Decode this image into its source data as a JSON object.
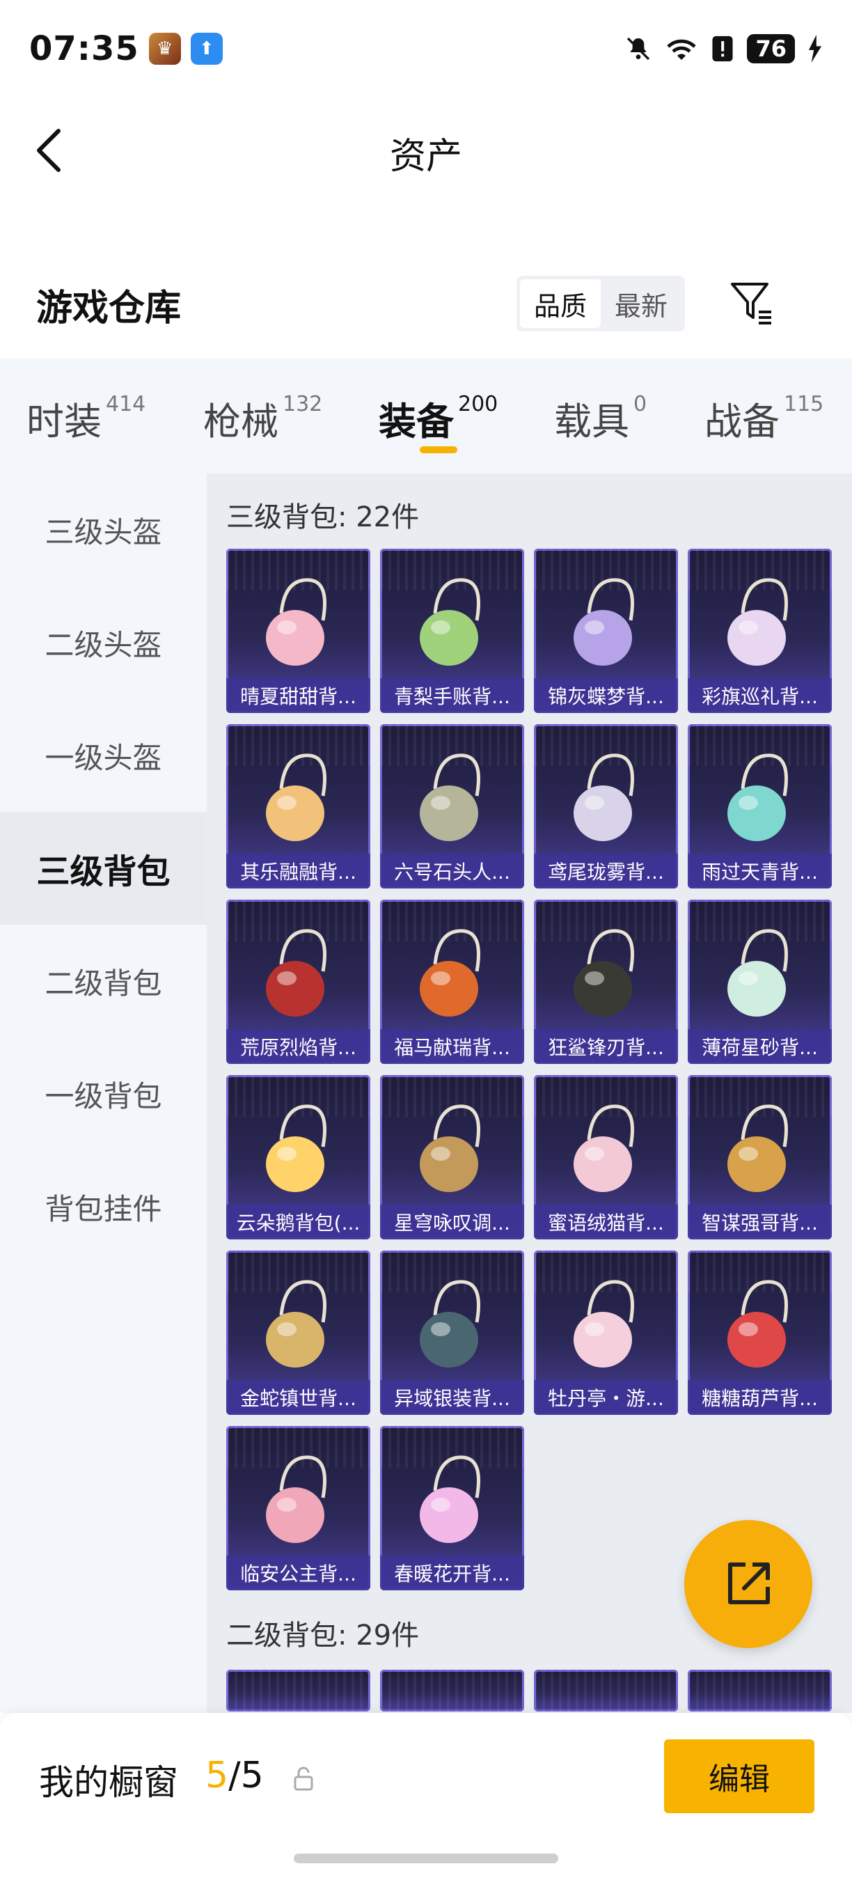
{
  "status_bar": {
    "time": "07:35",
    "battery": "76"
  },
  "header": {
    "title": "资产"
  },
  "warehouse": {
    "title": "游戏仓库",
    "sort_options": [
      "品质",
      "最新"
    ],
    "active_sort": "品质"
  },
  "tabs": [
    {
      "label": "时装",
      "count": "414"
    },
    {
      "label": "枪械",
      "count": "132"
    },
    {
      "label": "装备",
      "count": "200",
      "active": true
    },
    {
      "label": "载具",
      "count": "0"
    },
    {
      "label": "战备",
      "count": "115"
    }
  ],
  "sidebar": {
    "items": [
      "三级头盔",
      "二级头盔",
      "一级头盔",
      "三级背包",
      "二级背包",
      "一级背包",
      "背包挂件"
    ],
    "active": "三级背包"
  },
  "sections": [
    {
      "title": "三级背包: 22件",
      "items": [
        {
          "name": "晴夏甜甜背...",
          "color": "#f4b8c8"
        },
        {
          "name": "青梨手账背...",
          "color": "#9fd27a"
        },
        {
          "name": "锦灰蝶梦背...",
          "color": "#b7a4e8"
        },
        {
          "name": "彩旗巡礼背...",
          "color": "#e9d6f0"
        },
        {
          "name": "其乐融融背...",
          "color": "#f2c27a"
        },
        {
          "name": "六号石头人...",
          "color": "#b5b59a"
        },
        {
          "name": "鸢尾珑雾背...",
          "color": "#d8d3e8"
        },
        {
          "name": "雨过天青背...",
          "color": "#7fd8d0"
        },
        {
          "name": "荒原烈焰背...",
          "color": "#b8332f"
        },
        {
          "name": "福马献瑞背...",
          "color": "#e06a2c"
        },
        {
          "name": "狂鲨锋刃背...",
          "color": "#3a3a34"
        },
        {
          "name": "薄荷星砂背...",
          "color": "#cfeee0"
        },
        {
          "name": "云朵鹅背包(...",
          "color": "#ffd36a"
        },
        {
          "name": "星穹咏叹调...",
          "color": "#c39a5a"
        },
        {
          "name": "蜜语绒猫背...",
          "color": "#f3c9d6"
        },
        {
          "name": "智谋强哥背...",
          "color": "#d8a24a"
        },
        {
          "name": "金蛇镇世背...",
          "color": "#d9b56a"
        },
        {
          "name": "异域银装背...",
          "color": "#4a6670"
        },
        {
          "name": "牡丹亭・游...",
          "color": "#f5d0dc"
        },
        {
          "name": "糖糖葫芦背...",
          "color": "#e04848"
        },
        {
          "name": "临安公主背...",
          "color": "#f0a7b8"
        },
        {
          "name": "春暖花开背...",
          "color": "#f1b8e8"
        }
      ]
    },
    {
      "title": "二级背包: 29件"
    }
  ],
  "showcase": {
    "label": "我的橱窗",
    "current": "5",
    "total": "/5"
  },
  "edit_label": "编辑",
  "icons": {
    "back": "back-arrow-icon",
    "filter": "filter-icon",
    "share": "share-icon",
    "lock": "lock-icon",
    "mute": "mute-icon",
    "wifi": "wifi-icon",
    "alert": "alert-icon",
    "charging": "charging-icon"
  },
  "colors": {
    "accent": "#f6b200",
    "card_bg": "#2b2856",
    "card_label": "#3c3296"
  }
}
